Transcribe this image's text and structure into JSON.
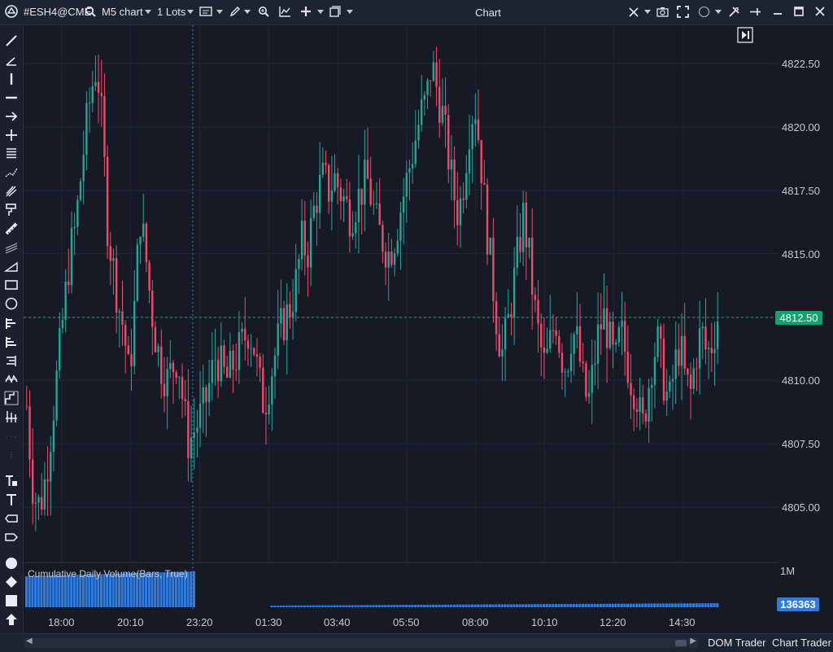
{
  "titlebar": {
    "app_icon": "logo-icon",
    "symbol": "#ESH4@CME",
    "chart_type": "M5 chart",
    "lots": "1 Lots",
    "window_title": "Chart"
  },
  "price_scale": {
    "labels": [
      "4822.50",
      "4820.00",
      "4817.50",
      "4815.00",
      "4812.50",
      "4810.00",
      "4807.50",
      "4805.00"
    ],
    "current_price": "4812.50"
  },
  "time_axis": {
    "labels": [
      "18:00",
      "20:10",
      "23:20",
      "01:30",
      "03:40",
      "05:50",
      "08:00",
      "10:10",
      "12:20",
      "14:30"
    ]
  },
  "indicator": {
    "label": "Cumulative Daily Volume(Bars, True)",
    "scale_max": "1M",
    "current_value": "136363"
  },
  "bottombar": {
    "dom_trader": "DOM Trader",
    "chart_trader": "Chart Trader"
  },
  "colors": {
    "up": "#26a69a",
    "down": "#ef4b6c",
    "volume": "#2f7be0",
    "price_line": "#13a36e"
  },
  "chart_data": {
    "type": "candlestick",
    "interval": "M5",
    "ylim": [
      4803.0,
      4824.0
    ],
    "path": [
      [
        0,
        4809.0
      ],
      [
        1,
        4806.0
      ],
      [
        2,
        4805.0
      ],
      [
        3,
        4805.5
      ],
      [
        4,
        4807.0
      ],
      [
        5,
        4809.0
      ],
      [
        6,
        4811.0
      ],
      [
        7,
        4813.0
      ],
      [
        8,
        4815.0
      ],
      [
        9,
        4816.0
      ],
      [
        10,
        4818.0
      ],
      [
        11,
        4820.0
      ],
      [
        12,
        4821.5
      ],
      [
        13,
        4822.5
      ],
      [
        14,
        4820.0
      ],
      [
        15,
        4816.0
      ],
      [
        16,
        4814.5
      ],
      [
        17,
        4813.0
      ],
      [
        18,
        4812.0
      ],
      [
        19,
        4810.0
      ],
      [
        20,
        4813.0
      ],
      [
        21,
        4816.5
      ],
      [
        22,
        4815.0
      ],
      [
        23,
        4813.0
      ],
      [
        24,
        4811.5
      ],
      [
        25,
        4810.5
      ],
      [
        26,
        4810.0
      ],
      [
        27,
        4810.5
      ],
      [
        28,
        4811.0
      ],
      [
        29,
        4809.0
      ],
      [
        30,
        4807.5
      ],
      [
        31,
        4808.0
      ],
      [
        32,
        4808.5
      ],
      [
        33,
        4809.0
      ],
      [
        34,
        4810.0
      ],
      [
        35,
        4811.0
      ],
      [
        36,
        4810.5
      ],
      [
        37,
        4810.0
      ],
      [
        38,
        4810.5
      ],
      [
        39,
        4811.0
      ],
      [
        40,
        4811.5
      ],
      [
        41,
        4812.0
      ],
      [
        42,
        4811.5
      ],
      [
        43,
        4810.0
      ],
      [
        44,
        4809.0
      ],
      [
        45,
        4810.0
      ],
      [
        46,
        4811.0
      ],
      [
        47,
        4812.0
      ],
      [
        48,
        4812.5
      ],
      [
        49,
        4813.0
      ],
      [
        50,
        4814.0
      ],
      [
        51,
        4815.5
      ],
      [
        52,
        4815.0
      ],
      [
        53,
        4816.5
      ],
      [
        54,
        4817.5
      ],
      [
        55,
        4818.0
      ],
      [
        56,
        4817.5
      ],
      [
        57,
        4818.0
      ],
      [
        58,
        4817.5
      ],
      [
        59,
        4817.0
      ],
      [
        60,
        4816.5
      ],
      [
        61,
        4817.0
      ],
      [
        62,
        4817.5
      ],
      [
        63,
        4818.0
      ],
      [
        64,
        4817.0
      ],
      [
        65,
        4816.0
      ],
      [
        66,
        4815.5
      ],
      [
        67,
        4815.0
      ],
      [
        68,
        4815.5
      ],
      [
        69,
        4816.5
      ],
      [
        70,
        4817.5
      ],
      [
        71,
        4818.5
      ],
      [
        72,
        4819.5
      ],
      [
        73,
        4820.5
      ],
      [
        74,
        4821.0
      ],
      [
        75,
        4822.5
      ],
      [
        76,
        4821.5
      ],
      [
        77,
        4820.5
      ],
      [
        78,
        4819.0
      ],
      [
        79,
        4817.5
      ],
      [
        80,
        4816.5
      ],
      [
        81,
        4818.0
      ],
      [
        82,
        4820.0
      ],
      [
        83,
        4821.0
      ],
      [
        84,
        4819.0
      ],
      [
        85,
        4816.5
      ],
      [
        86,
        4814.5
      ],
      [
        87,
        4812.5
      ],
      [
        88,
        4811.0
      ],
      [
        89,
        4812.0
      ],
      [
        90,
        4813.5
      ],
      [
        91,
        4815.0
      ],
      [
        92,
        4816.5
      ],
      [
        93,
        4815.0
      ],
      [
        94,
        4813.0
      ],
      [
        95,
        4811.5
      ],
      [
        96,
        4810.5
      ],
      [
        97,
        4811.5
      ],
      [
        98,
        4812.5
      ],
      [
        99,
        4811.0
      ],
      [
        100,
        4810.5
      ],
      [
        101,
        4812.0
      ],
      [
        102,
        4811.5
      ],
      [
        103,
        4810.0
      ],
      [
        104,
        4809.0
      ],
      [
        105,
        4810.5
      ],
      [
        106,
        4812.0
      ],
      [
        107,
        4812.5
      ],
      [
        108,
        4811.5
      ],
      [
        109,
        4810.5
      ],
      [
        110,
        4812.0
      ],
      [
        111,
        4811.0
      ],
      [
        112,
        4810.0
      ],
      [
        113,
        4809.5
      ],
      [
        114,
        4808.0
      ],
      [
        115,
        4809.5
      ],
      [
        116,
        4811.0
      ],
      [
        117,
        4811.5
      ],
      [
        118,
        4810.0
      ],
      [
        119,
        4809.0
      ],
      [
        120,
        4810.5
      ],
      [
        121,
        4811.5
      ],
      [
        122,
        4810.0
      ],
      [
        123,
        4809.5
      ],
      [
        124,
        4811.0
      ],
      [
        125,
        4812.0
      ],
      [
        126,
        4811.0
      ],
      [
        127,
        4811.5
      ],
      [
        128,
        4812.5
      ]
    ],
    "session_break_time": "23:20"
  }
}
